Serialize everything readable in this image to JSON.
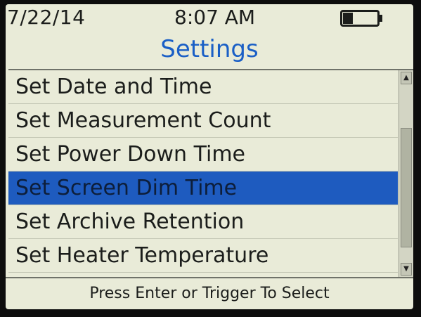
{
  "status_bar": {
    "date": "7/22/14",
    "time": "8:07 AM",
    "battery_level_fraction": 0.3,
    "battery_icon": "battery-icon"
  },
  "header": {
    "title": "Settings"
  },
  "menu": {
    "items": [
      {
        "label": "Set Date and Time",
        "selected": false
      },
      {
        "label": "Set Measurement Count",
        "selected": false
      },
      {
        "label": "Set Power Down Time",
        "selected": false
      },
      {
        "label": "Set Screen Dim Time",
        "selected": true
      },
      {
        "label": "Set Archive Retention",
        "selected": false
      },
      {
        "label": "Set Heater Temperature",
        "selected": false
      }
    ]
  },
  "scrollbar": {
    "up_arrow_icon": "scroll-up-arrow-icon",
    "down_arrow_icon": "scroll-down-arrow-icon",
    "up_glyph": "▲",
    "down_glyph": "▼"
  },
  "footer": {
    "hint": "Press Enter or Trigger To Select"
  },
  "colors": {
    "screen_background": "#e9ebd8",
    "title_color": "#1a5fc6",
    "selection_highlight": "#1e5bbf"
  }
}
